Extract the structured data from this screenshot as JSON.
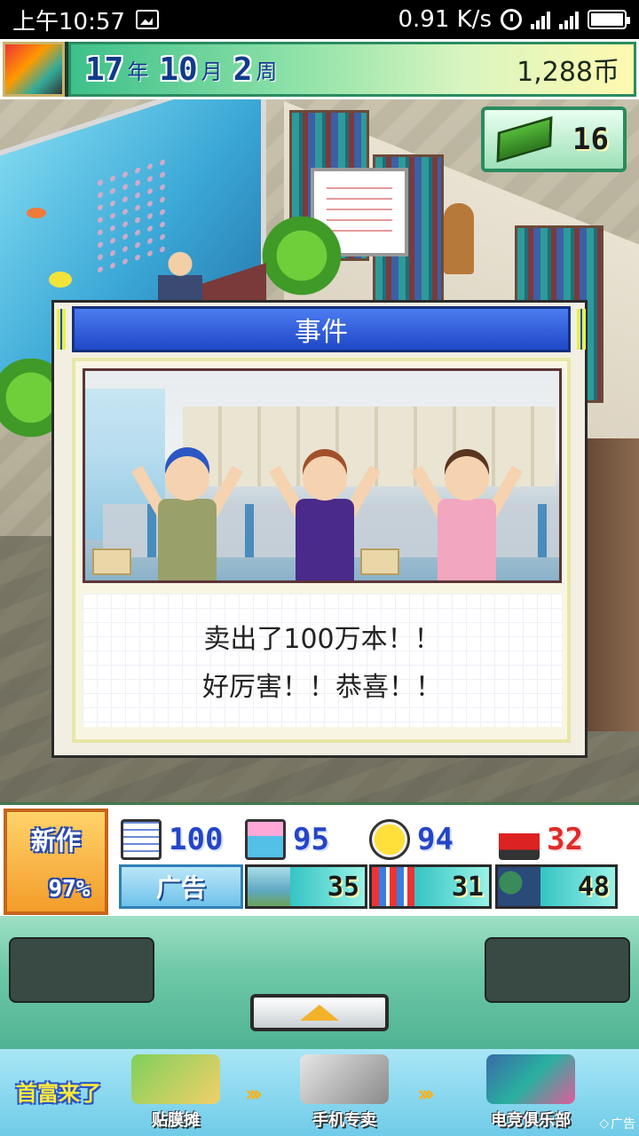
{
  "status_bar": {
    "time": "上午10:57",
    "speed": "0.91 K/s",
    "network_a": "3G",
    "network_b": "4G"
  },
  "hud": {
    "year_num": "17",
    "year_unit": "年",
    "month_num": "10",
    "month_unit": "月",
    "week_num": "2",
    "week_unit": "周",
    "money": "1,288币",
    "cash_count": "16"
  },
  "dialog": {
    "title": "事件",
    "message_line1": "卖出了100万本！！",
    "message_line2": "好厉害！！恭喜！！"
  },
  "panel": {
    "new_title": "新作",
    "new_progress": "97%",
    "stats": [
      {
        "icon": "document-icon",
        "value": "100"
      },
      {
        "icon": "photo-icon",
        "value": "95"
      },
      {
        "icon": "smiley-icon",
        "value": "94"
      },
      {
        "icon": "printer-icon",
        "value": "32"
      }
    ],
    "ad_label": "广告",
    "ad_slots": [
      {
        "icon": "landscape-icon",
        "value": "35"
      },
      {
        "icon": "building-icon",
        "value": "31"
      },
      {
        "icon": "people-icon",
        "value": "48"
      }
    ]
  },
  "banner": {
    "logo": "首富来了",
    "items": [
      "贴膜摊",
      "手机专卖",
      "电竞俱乐部"
    ],
    "ad_tag": "广告"
  },
  "colors": {
    "title_bar": "#1e48c8",
    "stat_blue": "#2445c8",
    "stat_red": "#e02a2a",
    "new_orange": "#f39c2a"
  }
}
